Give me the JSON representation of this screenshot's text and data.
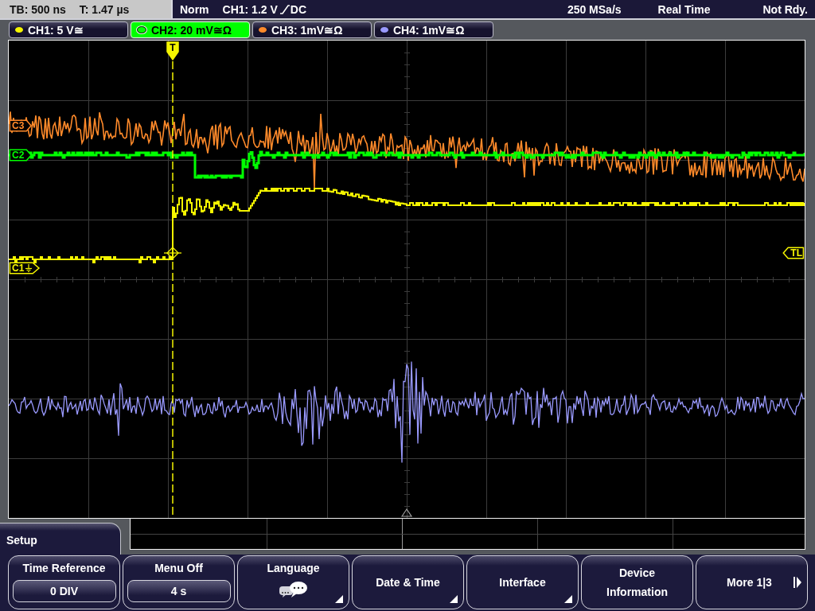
{
  "status_bar": {
    "timebase": "TB: 500 ns",
    "trigger_time": "T: 1.47 µs",
    "trigger_mode": "Norm",
    "trigger_source": "CH1: 1.2 V",
    "trigger_coupling": "DC",
    "sample_rate": "250 MSa/s",
    "acquisition_mode": "Real Time",
    "status": "Not Rdy."
  },
  "channels": [
    {
      "label": "CH1: 5 V≅",
      "color": "#f5f500",
      "selected": false
    },
    {
      "label": "CH2: 20 mV≅Ω",
      "color": "#00ff00",
      "selected": true
    },
    {
      "label": "CH3: 1mV≅Ω",
      "color": "#ff8a2a",
      "selected": false
    },
    {
      "label": "CH4: 1mV≅Ω",
      "color": "#9a9aff",
      "selected": false
    }
  ],
  "display": {
    "markers": [
      {
        "label": "C3",
        "color": "#ff8a2a",
        "ground": false
      },
      {
        "label": "C2",
        "color": "#00ff00",
        "ground": false
      },
      {
        "label": "C1",
        "color": "#f5f500",
        "ground": true
      }
    ],
    "trigger_position": "T",
    "trigger_level": "TL"
  },
  "menu": {
    "title": "Setup",
    "buttons": [
      {
        "label": "Time Reference",
        "kind": "value",
        "value": "0 DIV",
        "submenu": false
      },
      {
        "label": "Menu Off",
        "kind": "value",
        "value": "4 s",
        "submenu": false
      },
      {
        "label": "Language",
        "kind": "icon",
        "submenu": true
      },
      {
        "label": "Date & Time",
        "kind": "plain",
        "submenu": true
      },
      {
        "label": "Interface",
        "kind": "plain",
        "submenu": true
      },
      {
        "label": "Device Information",
        "kind": "plain",
        "submenu": false
      },
      {
        "label": "More 1|3",
        "kind": "next",
        "submenu": false
      }
    ]
  }
}
